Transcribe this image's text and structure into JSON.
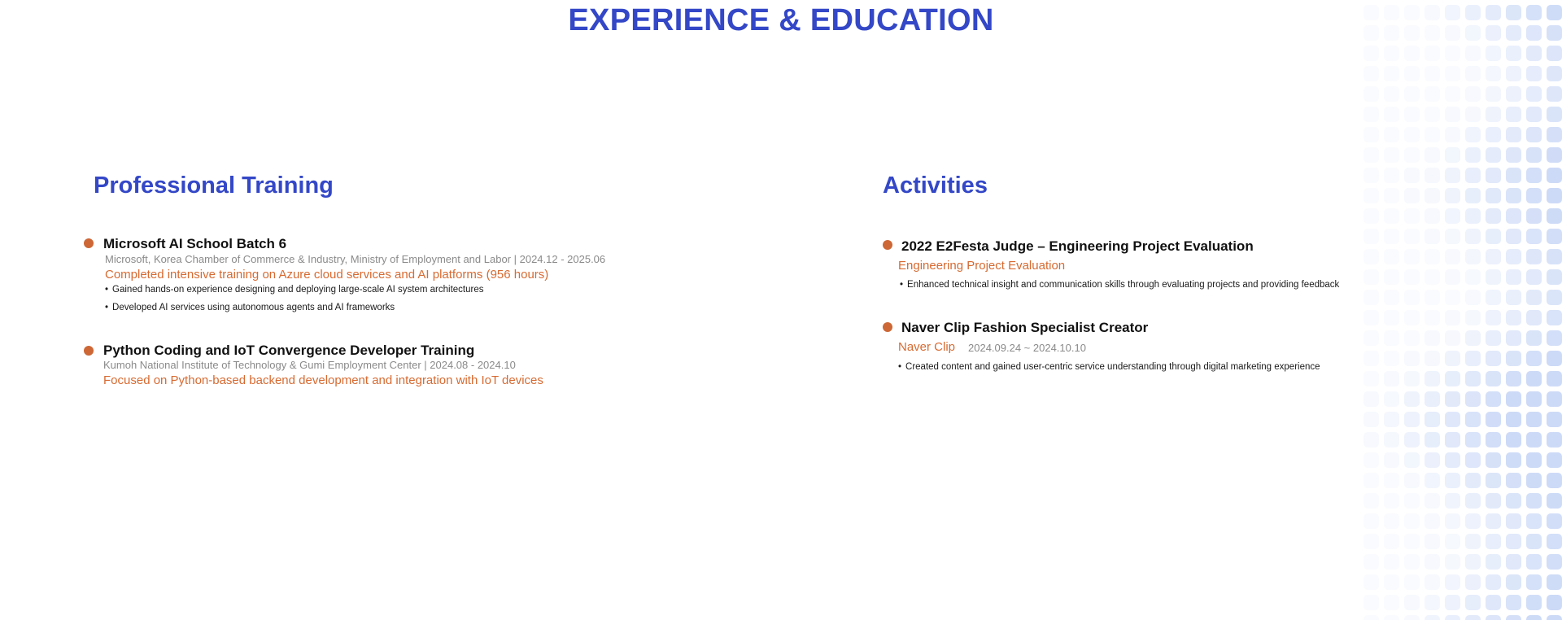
{
  "page": {
    "title": "EXPERIENCE & EDUCATION",
    "accent_color": "#3347c7",
    "highlight_color": "#d76a31",
    "dot_color": "#cd6735"
  },
  "training": {
    "heading": "Professional Training",
    "items": [
      {
        "title": "Microsoft AI School Batch 6",
        "meta": "Microsoft, Korea Chamber of Commerce & Industry, Ministry of Employment and Labor | 2024.12 - 2025.06",
        "highlight": "Completed intensive training on Azure cloud services and AI platforms (956 hours)",
        "bullets": [
          "Gained hands-on experience designing and deploying large-scale AI system architectures",
          "Developed AI services using autonomous agents and AI frameworks"
        ]
      },
      {
        "title": "Python Coding and IoT Convergence Developer Training",
        "meta": "Kumoh National Institute of Technology & Gumi Employment Center | 2024.08 - 2024.10",
        "highlight": "Focused on Python-based backend development and integration with IoT devices"
      }
    ]
  },
  "activities": {
    "heading": "Activities",
    "items": [
      {
        "title": "2022 E2Festa Judge – Engineering Project Evaluation",
        "highlight": "Engineering Project Evaluation",
        "bullets": [
          "Enhanced technical insight and communication skills through evaluating projects and providing feedback"
        ]
      },
      {
        "title": "Naver Clip Fashion Specialist Creator",
        "highlight": "Naver Clip",
        "date": "2024.09.24 ~ 2024.10.10",
        "bullets": [
          "Created content and gained user-centric service understanding through digital marketing experience"
        ]
      }
    ]
  }
}
